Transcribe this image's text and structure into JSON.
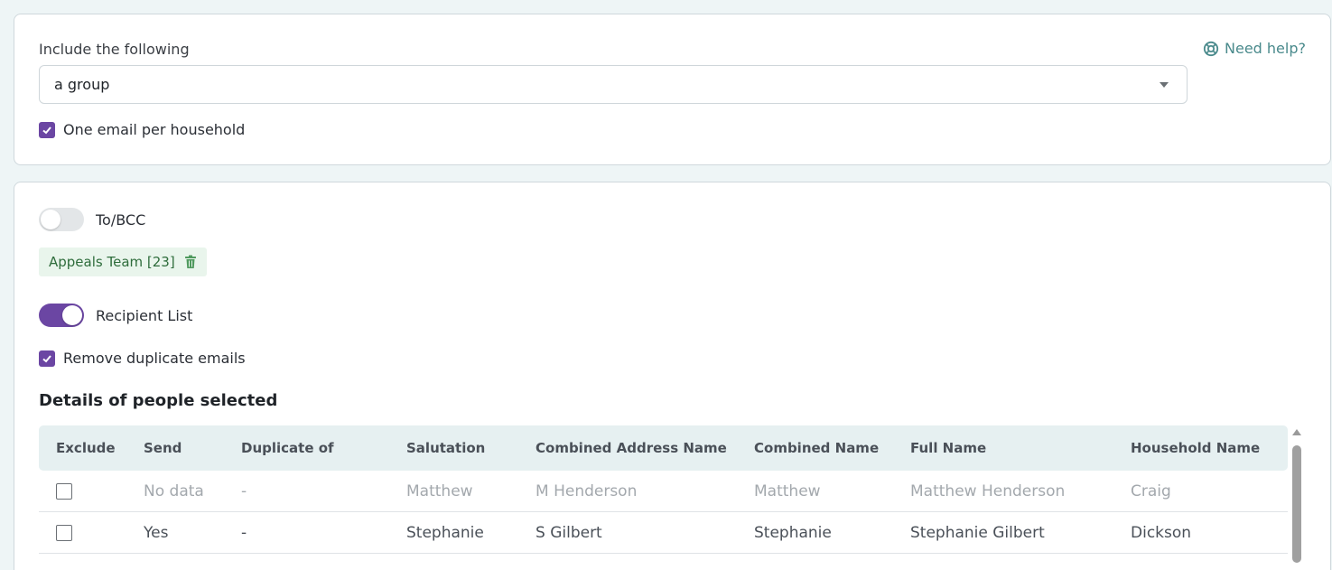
{
  "filters": {
    "include_label": "Include the following",
    "include_value": "a group",
    "help_label": "Need help?",
    "one_email_label": "One email per household",
    "one_email_checked": true
  },
  "recipients": {
    "to_bcc_label": "To/BCC",
    "to_bcc_on": false,
    "group_chip": "Appeals Team [23]",
    "recipient_list_label": "Recipient List",
    "recipient_list_on": true,
    "remove_duplicates_label": "Remove duplicate emails",
    "remove_duplicates_checked": true
  },
  "details": {
    "title": "Details of people selected",
    "columns": [
      "Exclude",
      "Send",
      "Duplicate of",
      "Salutation",
      "Combined Address Name",
      "Combined Name",
      "Full Name",
      "Household Name"
    ],
    "rows": [
      {
        "send": "No data",
        "duplicate_of": "-",
        "salutation": "Matthew",
        "combined_address_name": "M Henderson",
        "combined_name": "Matthew",
        "full_name": "Matthew Henderson",
        "household_name": "Craig"
      },
      {
        "send": "Yes",
        "duplicate_of": "-",
        "salutation": "Stephanie",
        "combined_address_name": "S Gilbert",
        "combined_name": "Stephanie",
        "full_name": "Stephanie Gilbert",
        "household_name": "Dickson"
      }
    ]
  },
  "colors": {
    "accent": "#6b46a3",
    "help": "#4a8a8c",
    "chip_bg": "#e9f5ec",
    "chip_text": "#2f6d3c",
    "table_header_bg": "#e6f0f1"
  }
}
